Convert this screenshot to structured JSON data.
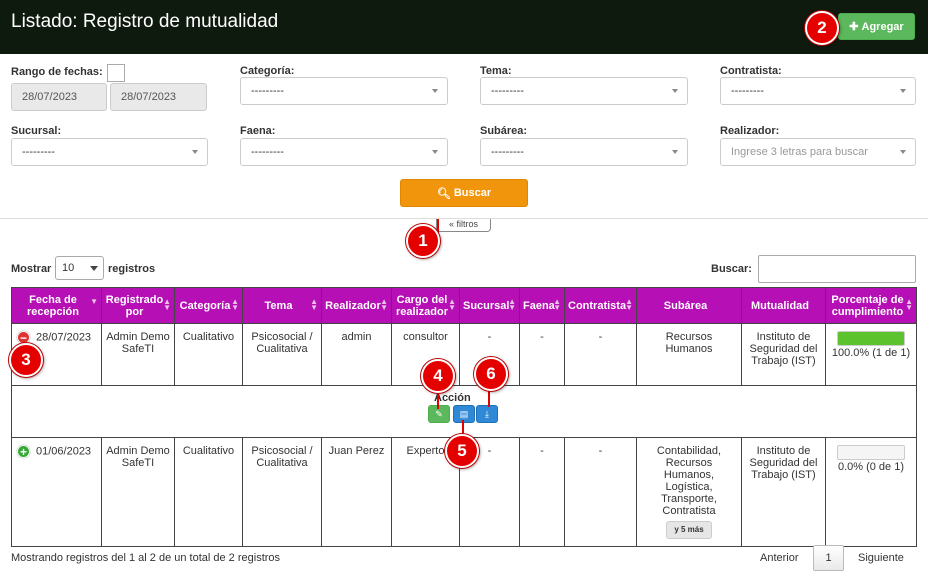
{
  "header": {
    "title": "Listado: Registro de mutualidad",
    "add_label": "Agregar"
  },
  "filters": {
    "date_label": "Rango de fechas:",
    "date_from": "28/07/2023",
    "date_to": "28/07/2023",
    "categoria": {
      "label": "Categoría:",
      "value": "---------"
    },
    "tema": {
      "label": "Tema:",
      "value": "---------"
    },
    "contratista": {
      "label": "Contratista:",
      "value": "---------"
    },
    "sucursal": {
      "label": "Sucursal:",
      "value": "---------"
    },
    "faena": {
      "label": "Faena:",
      "value": "---------"
    },
    "subarea": {
      "label": "Subárea:",
      "value": "---------"
    },
    "realizador": {
      "label": "Realizador:",
      "placeholder": "Ingrese 3 letras para buscar"
    },
    "search_label": "Buscar",
    "toggle_label": "filtros"
  },
  "table_controls": {
    "show_label": "Mostrar",
    "show_value": "10",
    "records_label": "registros",
    "search_label": "Buscar:"
  },
  "table": {
    "columns": [
      "Fecha de recepción",
      "Registrado por",
      "Categoría",
      "Tema",
      "Realizador",
      "Cargo del realizador",
      "Sucursal",
      "Faena",
      "Contratista",
      "Subárea",
      "Mutualidad",
      "Porcentaje de cumplimiento"
    ],
    "rows": [
      {
        "fecha": "28/07/2023",
        "registrado": "Admin Demo SafeTI",
        "categoria": "Cualitativo",
        "tema": "Psicosocial / Cualitativa",
        "realizador": "admin",
        "cargo": "consultor",
        "sucursal": "-",
        "faena": "-",
        "contratista": "-",
        "subarea": "Recursos Humanos",
        "mutualidad": "Instituto de Seguridad del Trabajo (IST)",
        "porcentaje": "100.0% (1 de 1)",
        "progress": 1.0
      },
      {
        "fecha": "01/06/2023",
        "registrado": "Admin Demo SafeTI",
        "categoria": "Cualitativo",
        "tema": "Psicosocial / Cualitativa",
        "realizador": "Juan Perez",
        "cargo": "Experto",
        "sucursal": "-",
        "faena": "-",
        "contratista": "-",
        "subarea": "Contabilidad, Recursos Humanos, Logística, Transporte, Contratista",
        "more": "y 5 más",
        "mutualidad": "Instituto de Seguridad del Trabajo (IST)",
        "porcentaje": "0.0% (0 de 1)",
        "progress": 0.0
      }
    ],
    "action_title": "Acción"
  },
  "footer": {
    "info": "Mostrando registros del 1 al 2 de un total de 2 registros",
    "prev": "Anterior",
    "page": "1",
    "next": "Siguiente"
  },
  "markers": [
    "1",
    "2",
    "3",
    "4",
    "5",
    "6"
  ],
  "colors": {
    "header_bg": "#0e1a0e",
    "table_header": "#b50fb5",
    "add_button": "#5cb85c",
    "search_button": "#f0950c",
    "marker": "#e50000"
  }
}
